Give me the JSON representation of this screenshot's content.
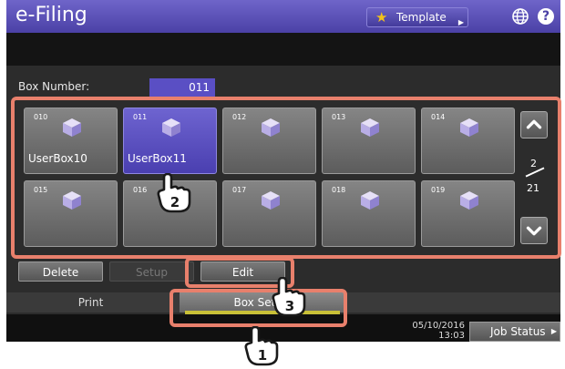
{
  "header": {
    "app_title": "e-Filing",
    "template_label": "Template"
  },
  "form": {
    "box_number_label": "Box Number:",
    "box_number_value": "011"
  },
  "boxes": [
    {
      "num": "010",
      "name": "UserBox10"
    },
    {
      "num": "011",
      "name": "UserBox11"
    },
    {
      "num": "012",
      "name": ""
    },
    {
      "num": "013",
      "name": ""
    },
    {
      "num": "014",
      "name": ""
    },
    {
      "num": "015",
      "name": ""
    },
    {
      "num": "016",
      "name": ""
    },
    {
      "num": "017",
      "name": ""
    },
    {
      "num": "018",
      "name": ""
    },
    {
      "num": "019",
      "name": ""
    }
  ],
  "pager": {
    "current": "2",
    "total": "21"
  },
  "actions": {
    "delete": "Delete",
    "setup": "Setup",
    "edit": "Edit"
  },
  "tabs": {
    "print": "Print",
    "box_setup": "Box Setup"
  },
  "status": {
    "date": "05/10/2016",
    "time": "13:03",
    "job_status": "Job Status"
  },
  "callouts": [
    "1",
    "2",
    "3"
  ],
  "colors": {
    "accent": "#4b41a6",
    "highlight": "#e8806c",
    "selected_box": "#5a4fc4"
  }
}
